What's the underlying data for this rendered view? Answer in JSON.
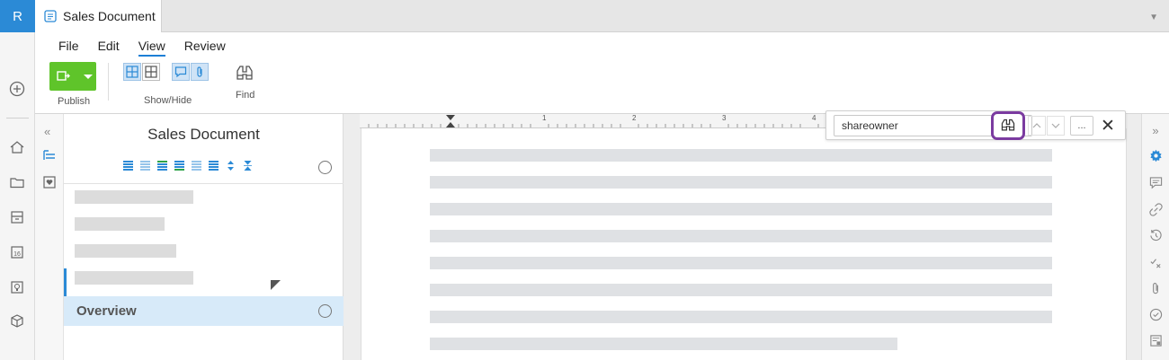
{
  "app": {
    "logo_letter": "R",
    "tab_title": "Sales Document"
  },
  "menu": {
    "items": [
      "File",
      "Edit",
      "View",
      "Review"
    ],
    "active": "View"
  },
  "ribbon": {
    "publish_label": "Publish",
    "showhide_label": "Show/Hide",
    "find_label": "Find"
  },
  "outline": {
    "title": "Sales Document",
    "overview_label": "Overview"
  },
  "find": {
    "value": "shareowner",
    "more_label": "...",
    "close_label": "✕"
  },
  "ruler": {
    "marks": [
      "1",
      "2",
      "3",
      "4"
    ]
  },
  "colors": {
    "accent": "#2b8ad6",
    "publish_green": "#5fc42a",
    "highlight_ring": "#7b3ba0",
    "overview_bg": "#d7eaf9"
  }
}
